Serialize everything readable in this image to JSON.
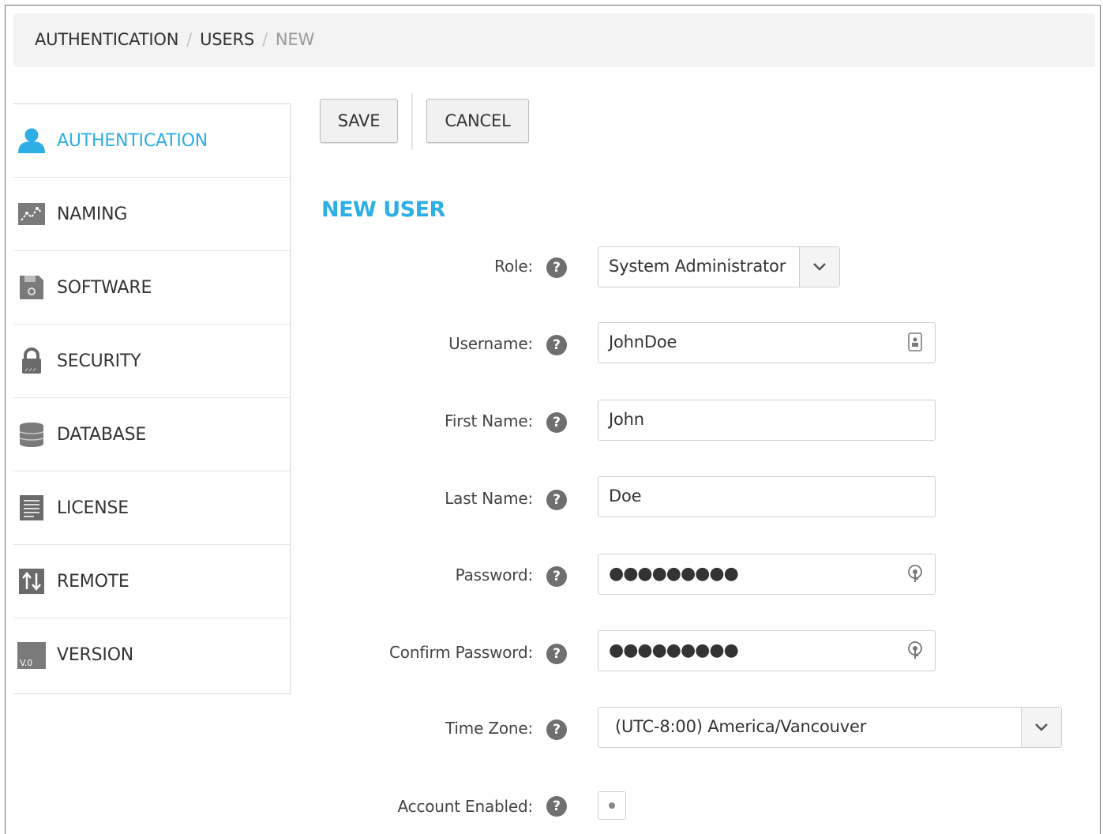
{
  "breadcrumb": {
    "items": [
      "AUTHENTICATION",
      "USERS"
    ],
    "current": "NEW",
    "separator": "/"
  },
  "sidebar": {
    "items": [
      {
        "label": "AUTHENTICATION",
        "icon": "user-icon",
        "active": true
      },
      {
        "label": "NAMING",
        "icon": "naming-icon"
      },
      {
        "label": "SOFTWARE",
        "icon": "software-icon"
      },
      {
        "label": "SECURITY",
        "icon": "lock-icon"
      },
      {
        "label": "DATABASE",
        "icon": "database-icon"
      },
      {
        "label": "LICENSE",
        "icon": "license-icon"
      },
      {
        "label": "REMOTE",
        "icon": "transfer-icon"
      },
      {
        "label": "VERSION",
        "icon": "version-icon",
        "icon_text": "V.0"
      }
    ]
  },
  "toolbar": {
    "save_label": "SAVE",
    "cancel_label": "CANCEL"
  },
  "form": {
    "title": "NEW USER",
    "help_glyph": "?",
    "role": {
      "label": "Role:",
      "value": "System Administrator"
    },
    "username": {
      "label": "Username:",
      "value": "JohnDoe"
    },
    "first_name": {
      "label": "First Name:",
      "value": "John"
    },
    "last_name": {
      "label": "Last Name:",
      "value": "Doe"
    },
    "password": {
      "label": "Password:",
      "value": "●●●●●●●●●"
    },
    "confirm_password": {
      "label": "Confirm Password:",
      "value": "●●●●●●●●●"
    },
    "time_zone": {
      "label": "Time Zone:",
      "value": "(UTC-8:00) America/Vancouver"
    },
    "account_enabled": {
      "label": "Account Enabled:",
      "checked": true
    }
  },
  "colors": {
    "accent": "#2dafe6",
    "help_bg": "#6f6f6f",
    "breadcrumb_bg": "#f3f3f3"
  }
}
